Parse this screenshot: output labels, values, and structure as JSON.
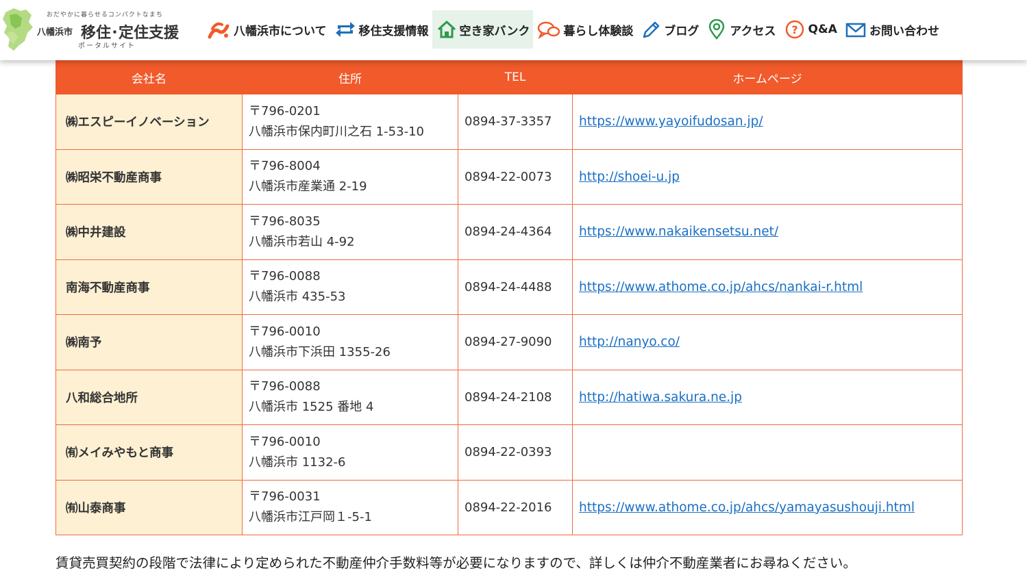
{
  "header": {
    "logo": {
      "tagline": "おだやかに暮らせるコンパクトなまち",
      "city": "八幡浜市",
      "main": "移住･定住支援",
      "sub": "ポータルサイト"
    },
    "nav": [
      {
        "label": "八幡浜市について",
        "icon": "city-logo-icon"
      },
      {
        "label": "移住支援情報",
        "icon": "arrows-cycle-icon"
      },
      {
        "label": "空き家バンク",
        "icon": "house-icon",
        "active": true
      },
      {
        "label": "暮らし体験談",
        "icon": "speech-bubbles-icon"
      },
      {
        "label": "ブログ",
        "icon": "pencil-icon"
      },
      {
        "label": "アクセス",
        "icon": "map-pin-icon"
      },
      {
        "label": "Q&A",
        "icon": "question-icon"
      },
      {
        "label": "お問い合わせ",
        "icon": "mail-icon"
      }
    ]
  },
  "table": {
    "headers": [
      "会社名",
      "住所",
      "TEL",
      "ホームページ"
    ],
    "rows": [
      {
        "company": "㈱エスピーイノベーション",
        "postal": "〒796-0201",
        "address": "八幡浜市保内町川之石 1-53-10",
        "tel": "0894-37-3357",
        "homepage": "https://www.yayoifudosan.jp/"
      },
      {
        "company": "㈱昭栄不動産商事",
        "postal": "〒796-8004",
        "address": "八幡浜市産業通 2-19",
        "tel": "0894-22-0073",
        "homepage": "http://shoei-u.jp"
      },
      {
        "company": "㈱中井建設",
        "postal": "〒796-8035",
        "address": "八幡浜市若山 4-92",
        "tel": "0894-24-4364",
        "homepage": "https://www.nakaikensetsu.net/"
      },
      {
        "company": "南海不動産商事",
        "postal": "〒796-0088",
        "address": "八幡浜市 435-53",
        "tel": "0894-24-4488",
        "homepage": "https://www.athome.co.jp/ahcs/nankai-r.html"
      },
      {
        "company": "㈱南予",
        "postal": "〒796-0010",
        "address": "八幡浜市下浜田 1355-26",
        "tel": "0894-27-9090",
        "homepage": "http://nanyo.co/"
      },
      {
        "company": "八和総合地所",
        "postal": "〒796-0088",
        "address": "八幡浜市 1525 番地 4",
        "tel": "0894-24-2108",
        "homepage": "http://hatiwa.sakura.ne.jp"
      },
      {
        "company": "㈲メイみやもと商事",
        "postal": "〒796-0010",
        "address": "八幡浜市 1132-6",
        "tel": "0894-22-0393",
        "homepage": ""
      },
      {
        "company": "㈲山泰商事",
        "postal": "〒796-0031",
        "address": "八幡浜市江戸岡１-5-1",
        "tel": "0894-22-2016",
        "homepage": "https://www.athome.co.jp/ahcs/yamayasushouji.html"
      }
    ]
  },
  "note": "賃貸売買契約の段階で法律により定められた不動産仲介手数料等が必要になりますので、詳しくは仲介不動産業者にお尋ねください。",
  "colors": {
    "accent": "#f15a2b",
    "company_cell": "#fdf0d3",
    "link": "#1a6fc4",
    "nav_active": "#e6f2ea"
  }
}
